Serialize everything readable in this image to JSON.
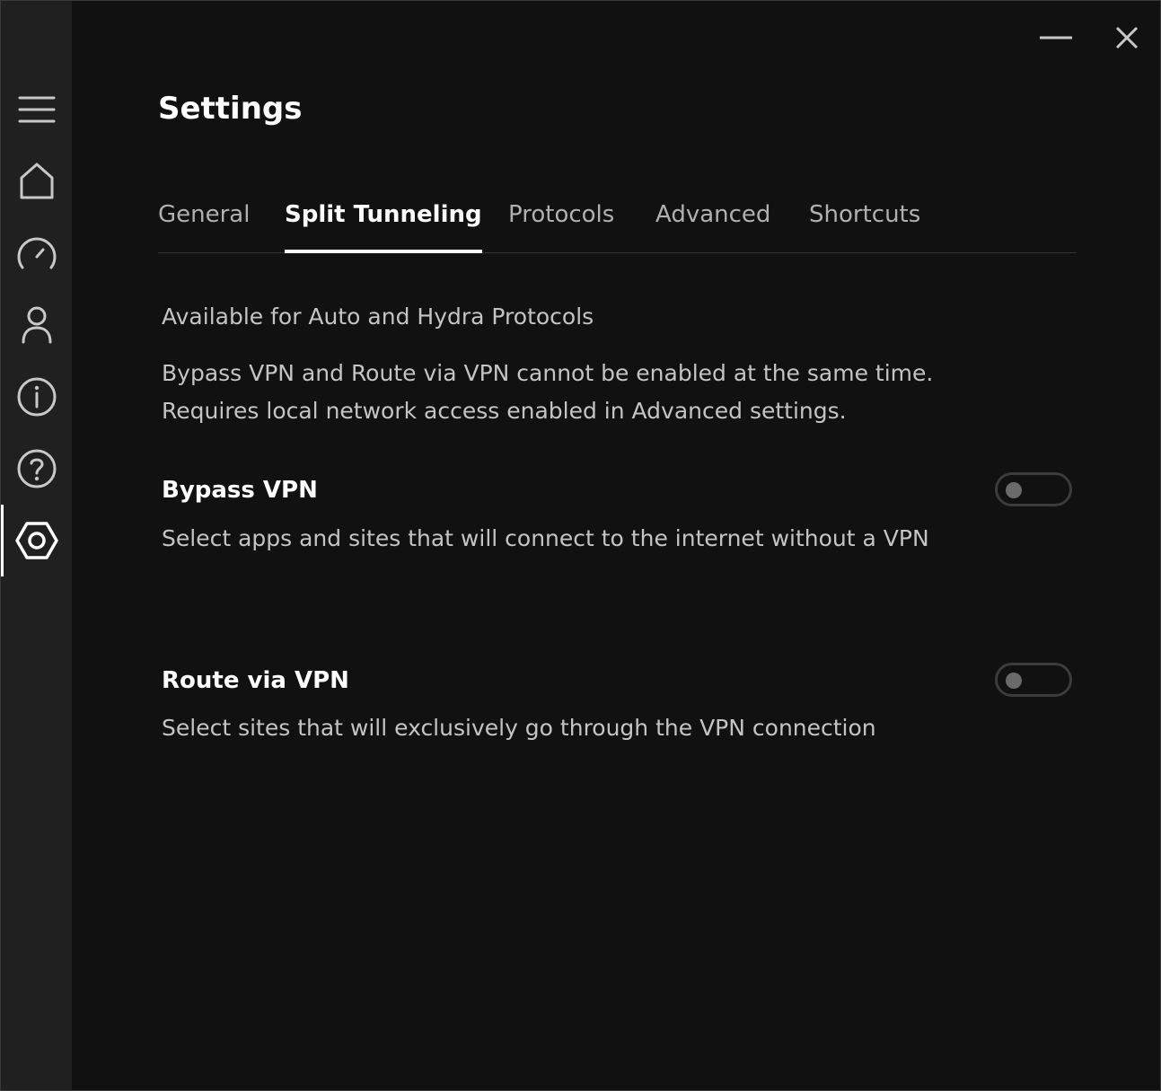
{
  "window": {
    "title": "Settings",
    "minimize_icon": "minimize-icon",
    "close_icon": "close-icon"
  },
  "sidebar": {
    "items": [
      {
        "name": "menu",
        "icon": "hamburger-menu-icon"
      },
      {
        "name": "home",
        "icon": "home-icon"
      },
      {
        "name": "speed",
        "icon": "speedometer-icon"
      },
      {
        "name": "account",
        "icon": "user-icon"
      },
      {
        "name": "info",
        "icon": "info-icon"
      },
      {
        "name": "help",
        "icon": "help-icon"
      },
      {
        "name": "settings",
        "icon": "settings-icon",
        "active": true
      }
    ]
  },
  "tabs": [
    {
      "label": "General",
      "active": false
    },
    {
      "label": "Split Tunneling",
      "active": true
    },
    {
      "label": "Protocols",
      "active": false
    },
    {
      "label": "Advanced",
      "active": false
    },
    {
      "label": "Shortcuts",
      "active": false
    }
  ],
  "split_tunneling": {
    "availability_note": "Available for Auto and Hydra Protocols",
    "constraint_note_line1": "Bypass VPN and Route via VPN cannot be enabled at the same time.",
    "constraint_note_line2": "Requires local network access enabled in Advanced settings.",
    "options": [
      {
        "title": "Bypass VPN",
        "description": "Select apps and sites that will connect to the internet without a VPN",
        "enabled": false
      },
      {
        "title": "Route via VPN",
        "description": "Select sites that will exclusively go through the VPN connection",
        "enabled": false
      }
    ]
  },
  "colors": {
    "background": "#111111",
    "sidebar": "#202020",
    "text_primary": "#ffffff",
    "text_secondary": "#c4c4c4"
  }
}
